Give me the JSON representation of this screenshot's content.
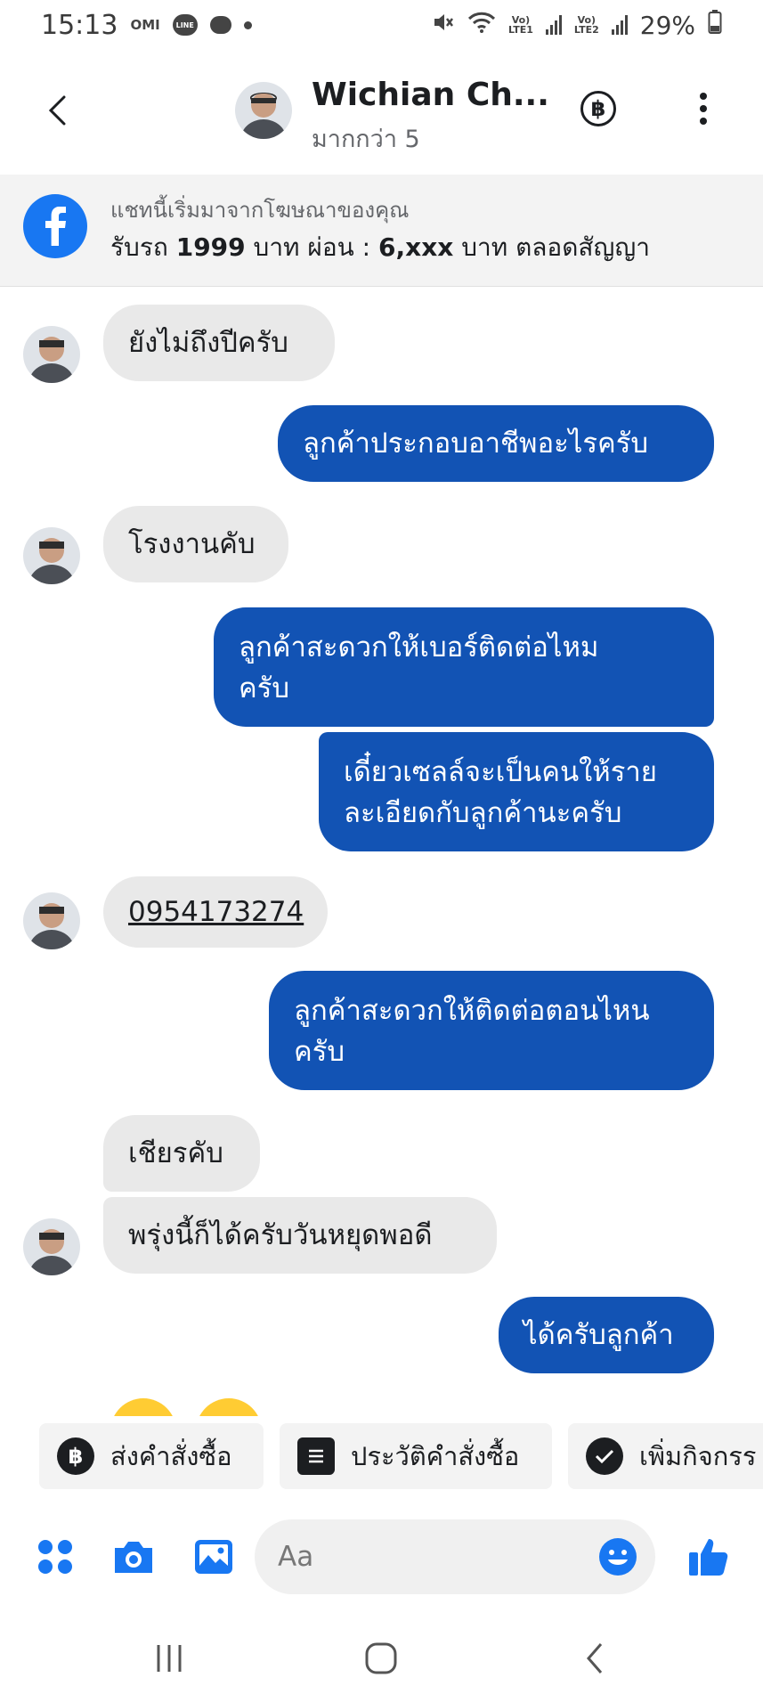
{
  "status_bar": {
    "time": "15:13",
    "notif_1": "OMI",
    "notif_2": "LINE",
    "sim1_top": "Vo)",
    "sim1_bottom": "LTE1",
    "sim2_top": "Vo)",
    "sim2_bottom": "LTE2",
    "battery": "29%"
  },
  "header": {
    "name": "Wichian Ch...",
    "subtitle": "มากกว่า 5",
    "currency_symbol": "฿"
  },
  "ad_banner": {
    "caption": "แชทนี้เริ่มมาจากโฆษณาของคุณ",
    "title_part1": "รับรถ ",
    "title_bold1": "1999",
    "title_part2": " บาท ผ่อน : ",
    "title_bold2": "6,xxx",
    "title_part3": " บาท ตลอดสัญญา"
  },
  "messages": [
    {
      "dir": "in",
      "text": "ยังไม่ถึงปีครับ"
    },
    {
      "dir": "out",
      "text": "ลูกค้าประกอบอาชีพอะไรครับ"
    },
    {
      "dir": "in",
      "text": "โรงงานคับ"
    },
    {
      "dir": "out",
      "line1": "ลูกค้าสะดวกให้เบอร์ติดต่อไหม",
      "line2": "ครับ"
    },
    {
      "dir": "out",
      "line1": "เดี๋ยวเซลล์จะเป็นคนให้ราย",
      "line2": "ละเอียดกับลูกค้านะครับ"
    },
    {
      "dir": "in",
      "text": "0954173274"
    },
    {
      "dir": "out",
      "line1": "ลูกค้าสะดวกให้ติดต่อตอนไหน",
      "line2": "ครับ"
    },
    {
      "dir": "in",
      "text": "เชียรคับ"
    },
    {
      "dir": "in",
      "text": "พรุ่งนี้ก็ได้ครับวันหยุดพอดี"
    },
    {
      "dir": "out",
      "text": "ได้ครับลูกค้า"
    }
  ],
  "quick_actions": [
    {
      "label": "ส่งคำสั่งซื้อ",
      "icon": "baht-icon"
    },
    {
      "label": "ประวัติคำสั่งซื้อ",
      "icon": "list-icon"
    },
    {
      "label": "เพิ่มกิจกรร",
      "icon": "check-icon"
    }
  ],
  "composer": {
    "placeholder": "Aa"
  },
  "colors": {
    "outgoing_bubble": "#1253b4",
    "incoming_bubble": "#e9e9e9",
    "messenger_blue": "#1877f2"
  }
}
